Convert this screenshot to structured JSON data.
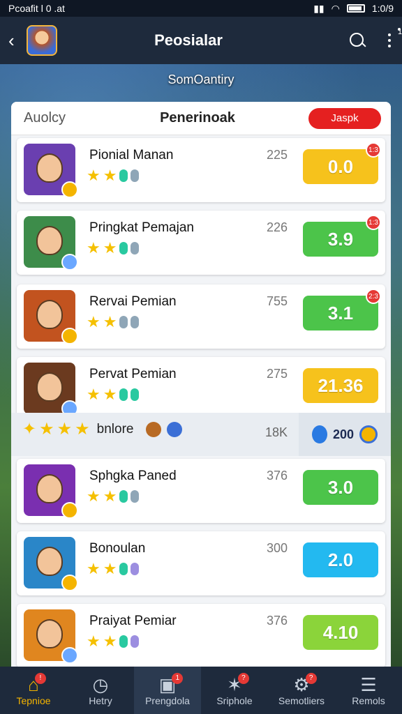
{
  "status_bar": {
    "left": "Pcoafit l 0 .at",
    "time": "1:0/9"
  },
  "app_bar": {
    "title": "Peosialar",
    "badge": "1"
  },
  "banner": "SomOantiry",
  "panel_header": {
    "left": "Auolcy",
    "title": "Penerinoak",
    "button": "Jaspk"
  },
  "rows": [
    {
      "name": "Pionial Manan",
      "count": "225",
      "score": "0.0",
      "score_color": "#f6c21c",
      "badge": "1:3",
      "coin": "gold",
      "avatar_bg": "#6a3fb0",
      "pill": [
        "green",
        "grey"
      ]
    },
    {
      "name": "Pringkat Pemajan",
      "count": "226",
      "score": "3.9",
      "score_color": "#4cc44a",
      "badge": "1:3",
      "coin": "blue",
      "avatar_bg": "#3d8c4a",
      "pill": [
        "green",
        "grey"
      ]
    },
    {
      "name": "Rervai Pemian",
      "count": "755",
      "score": "3.1",
      "score_color": "#4cc44a",
      "badge": "2:3",
      "coin": "gold",
      "avatar_bg": "#c2531f",
      "pill": [
        "grey",
        "grey"
      ]
    },
    {
      "name": "Pervat Pemian",
      "count": "275",
      "score": "21.36",
      "score_color": "#f6c21c",
      "badge": "",
      "coin": "blue",
      "avatar_bg": "#6b3a1f",
      "pill": [
        "green",
        "green"
      ]
    },
    {
      "name": "Sphgka Paned",
      "count": "376",
      "score": "3.0",
      "score_color": "#4cc44a",
      "badge": "",
      "coin": "gold",
      "avatar_bg": "#7a2fb0",
      "pill": [
        "green",
        "grey"
      ]
    },
    {
      "name": "Bonoulan",
      "count": "300",
      "score": "2.0",
      "score_color": "#23b9f0",
      "badge": "",
      "coin": "gold",
      "avatar_bg": "#2a86c8",
      "pill": [
        "green",
        "purple"
      ]
    },
    {
      "name": "Praiyat Pemiar",
      "count": "376",
      "score": "4.10",
      "score_color": "#8bd43a",
      "badge": "",
      "coin": "blue",
      "avatar_bg": "#e0861f",
      "pill": [
        "green",
        "purple"
      ]
    }
  ],
  "special_row": {
    "label": "bnlore",
    "count": "18K",
    "value": "200"
  },
  "bottom_nav": [
    {
      "label": "Tepnioe",
      "glyph": "⌂",
      "badge": "!"
    },
    {
      "label": "Hetry",
      "glyph": "◷",
      "badge": ""
    },
    {
      "label": "Prengdola",
      "glyph": "▣",
      "badge": "1"
    },
    {
      "label": "Sriphole",
      "glyph": "✶",
      "badge": "?"
    },
    {
      "label": "Semotliers",
      "glyph": "⚙",
      "badge": "?"
    },
    {
      "label": "Remols",
      "glyph": "☰",
      "badge": ""
    }
  ],
  "icons": {
    "back": "chevron-left-icon",
    "search": "search-icon",
    "more": "more-vert-icon"
  }
}
